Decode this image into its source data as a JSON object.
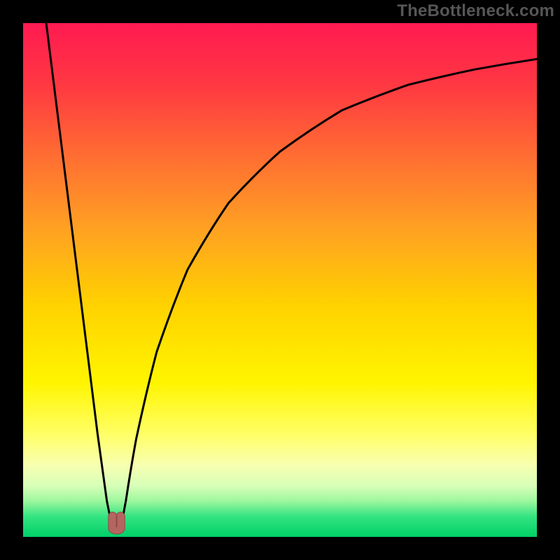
{
  "watermark": "TheBottleneck.com",
  "colors": {
    "frame": "#000000",
    "curve": "#000000",
    "marker_fill": "#b56560",
    "marker_stroke": "#8a4b47"
  },
  "chart_data": {
    "type": "line",
    "title": "",
    "xlabel": "",
    "ylabel": "",
    "xlim": [
      0,
      100
    ],
    "ylim": [
      0,
      100
    ],
    "background_gradient": [
      {
        "y_pct": 0,
        "color": "#ff1a51"
      },
      {
        "y_pct": 12,
        "color": "#ff3842"
      },
      {
        "y_pct": 25,
        "color": "#ff6a33"
      },
      {
        "y_pct": 40,
        "color": "#ffa122"
      },
      {
        "y_pct": 55,
        "color": "#ffd200"
      },
      {
        "y_pct": 70,
        "color": "#fff500"
      },
      {
        "y_pct": 80,
        "color": "#ffff66"
      },
      {
        "y_pct": 86,
        "color": "#f8ffb0"
      },
      {
        "y_pct": 90,
        "color": "#d8ffb8"
      },
      {
        "y_pct": 93,
        "color": "#9ef79e"
      },
      {
        "y_pct": 96,
        "color": "#34e481"
      },
      {
        "y_pct": 100,
        "color": "#00d068"
      }
    ],
    "curve_left_branch": [
      {
        "x": 4.5,
        "y": 100
      },
      {
        "x": 7,
        "y": 80
      },
      {
        "x": 9.5,
        "y": 60
      },
      {
        "x": 12,
        "y": 40
      },
      {
        "x": 14.5,
        "y": 20
      },
      {
        "x": 16.3,
        "y": 7
      },
      {
        "x": 17.2,
        "y": 2.5
      }
    ],
    "curve_right_branch": [
      {
        "x": 19.2,
        "y": 2.5
      },
      {
        "x": 20.0,
        "y": 7
      },
      {
        "x": 22,
        "y": 19
      },
      {
        "x": 26,
        "y": 36
      },
      {
        "x": 32,
        "y": 52
      },
      {
        "x": 40,
        "y": 65
      },
      {
        "x": 50,
        "y": 75
      },
      {
        "x": 62,
        "y": 83
      },
      {
        "x": 75,
        "y": 88
      },
      {
        "x": 88,
        "y": 91
      },
      {
        "x": 100,
        "y": 93
      }
    ],
    "marker": {
      "shape": "u-shape",
      "center_x_pct": 18.2,
      "bottom_y_pct": 0.8,
      "width_pct": 3.2,
      "height_pct": 3.2
    }
  }
}
